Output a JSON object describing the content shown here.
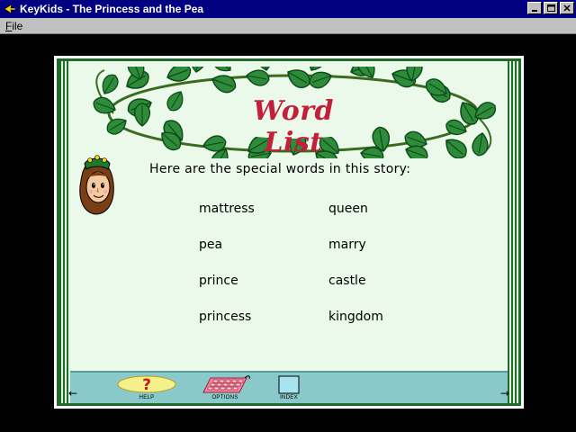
{
  "window": {
    "title": "KeyKids - The Princess and the Pea",
    "buttons": {
      "minimize": "_",
      "maximize": "□",
      "close": "✕"
    }
  },
  "menu": {
    "file_prefix": "F",
    "file_rest": "ile"
  },
  "page": {
    "title": "Word List",
    "intro": "Here are the special words in this story:",
    "words_left": [
      "mattress",
      "pea",
      "prince",
      "princess"
    ],
    "words_right": [
      "queen",
      "marry",
      "castle",
      "kingdom"
    ]
  },
  "toolbar": {
    "help_label": "HELP",
    "options_label": "OPTIONS",
    "index_label": "INDEX",
    "help_glyph": "?",
    "prev_arrow": "←",
    "next_arrow": "→"
  },
  "colors": {
    "titlebar": "#000080",
    "book_bg": "#eaf9ea",
    "book_border": "#1e6b2a",
    "toolbar_bg": "#8ac9c9",
    "title_red": "#c41e3a",
    "vine_green": "#2e8b3a"
  },
  "icons": {
    "app": "keykids-arrow-icon",
    "help": "help-question-icon",
    "options": "options-keyboard-icon",
    "index": "index-box-icon",
    "vine": "vine-leaves-icon",
    "princess": "princess-avatar-icon"
  }
}
